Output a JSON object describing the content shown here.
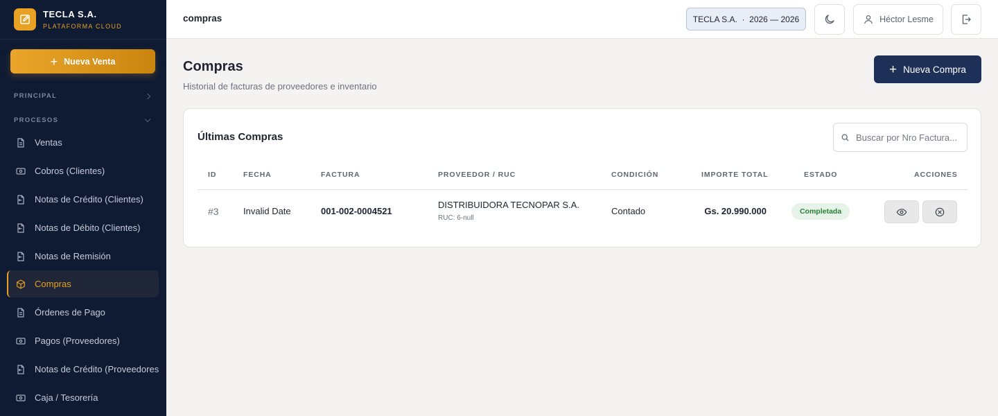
{
  "brand": {
    "name": "TECLA S.A.",
    "subtitle": "PLATAFORMA CLOUD",
    "accent": "#e8a122",
    "logo_icon": "edit-icon"
  },
  "sidebar": {
    "new_sale_label": "Nueva Venta",
    "sections": {
      "principal": "PRINCIPAL",
      "procesos": "PROCESOS"
    },
    "items": [
      {
        "label": "Ventas",
        "icon": "document-icon"
      },
      {
        "label": "Cobros (Clientes)",
        "icon": "cash-icon"
      },
      {
        "label": "Notas de Crédito (Clientes)",
        "icon": "receipt-return-icon"
      },
      {
        "label": "Notas de Débito (Clientes)",
        "icon": "receipt-return-icon"
      },
      {
        "label": "Notas de Remisión",
        "icon": "receipt-return-icon"
      },
      {
        "label": "Compras",
        "icon": "box-icon",
        "active": true
      },
      {
        "label": "Órdenes de Pago",
        "icon": "document-icon"
      },
      {
        "label": "Pagos (Proveedores)",
        "icon": "cash-icon"
      },
      {
        "label": "Notas de Crédito (Proveedores)",
        "icon": "receipt-return-icon"
      },
      {
        "label": "Caja / Tesorería",
        "icon": "cash-icon"
      }
    ]
  },
  "header": {
    "breadcrumb": "compras",
    "company_period": "TECLA S.A.  ·  2026 — 2026",
    "user_name": "Héctor Lesme"
  },
  "page": {
    "title": "Compras",
    "subtitle": "Historial de facturas de proveedores e inventario",
    "new_purchase_label": "Nueva Compra"
  },
  "table": {
    "title": "Últimas Compras",
    "search_placeholder": "Buscar por Nro Factura...",
    "columns": [
      "ID",
      "FECHA",
      "FACTURA",
      "PROVEEDOR / RUC",
      "CONDICIÓN",
      "IMPORTE TOTAL",
      "ESTADO",
      "ACCIONES"
    ],
    "rows": [
      {
        "id": "#3",
        "fecha": "Invalid Date",
        "factura": "001-002-0004521",
        "proveedor": "DISTRIBUIDORA TECNOPAR S.A.",
        "ruc": "RUC: 6-null",
        "condicion": "Contado",
        "importe": "Gs. 20.990.000",
        "estado": "Completada",
        "status_color": "#24803a"
      }
    ]
  }
}
